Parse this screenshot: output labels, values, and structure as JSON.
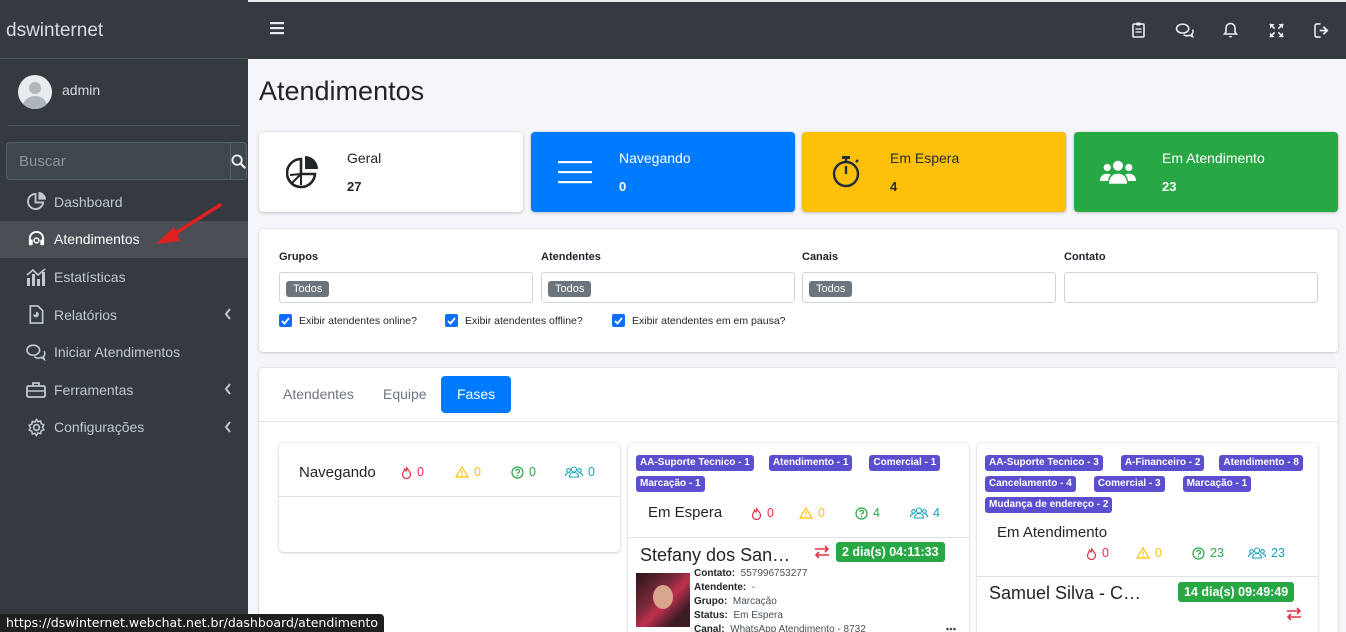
{
  "app": {
    "brand": "dswinternet"
  },
  "sidebar": {
    "user": "admin",
    "search_placeholder": "Buscar",
    "items": [
      {
        "label": "Dashboard"
      },
      {
        "label": "Atendimentos"
      },
      {
        "label": "Estatísticas"
      },
      {
        "label": "Relatórios"
      },
      {
        "label": "Iniciar Atendimentos"
      },
      {
        "label": "Ferramentas"
      },
      {
        "label": "Configurações"
      }
    ]
  },
  "page": {
    "title": "Atendimentos"
  },
  "stats": [
    {
      "label": "Geral",
      "value": "27"
    },
    {
      "label": "Navegando",
      "value": "0"
    },
    {
      "label": "Em Espera",
      "value": "4"
    },
    {
      "label": "Em Atendimento",
      "value": "23"
    }
  ],
  "filters": {
    "groups_label": "Grupos",
    "groups_value": "Todos",
    "agents_label": "Atendentes",
    "agents_value": "Todos",
    "channels_label": "Canais",
    "channels_value": "Todos",
    "contact_label": "Contato",
    "contact_value": "",
    "check_online": "Exibir atendentes online?",
    "check_offline": "Exibir atendentes offline?",
    "check_pause": "Exibir atendentes em em pausa?"
  },
  "tabs": [
    {
      "label": "Atendentes"
    },
    {
      "label": "Equipe"
    },
    {
      "label": "Fases"
    }
  ],
  "columns": {
    "navegando": {
      "title": "Navegando",
      "counts": [
        "0",
        "0",
        "0",
        "0"
      ]
    },
    "espera": {
      "title": "Em Espera",
      "badges": [
        "AA-Suporte Tecnico - 1",
        "Atendimento - 1",
        "Comercial - 1",
        "Marcação - 1"
      ],
      "counts": [
        "0",
        "0",
        "4",
        "4"
      ],
      "card": {
        "name": "Stefany dos San…",
        "timer": "2 dia(s) 04:11:33",
        "contato_label": "Contato:",
        "contato": "557996753277",
        "atendente_label": "Atendente:",
        "atendente": "-",
        "grupo_label": "Grupo:",
        "grupo": "Marcação",
        "status_label": "Status:",
        "status": "Em Espera",
        "canal_label": "Canal:",
        "canal": "WhatsApp Atendimento - 8732"
      }
    },
    "atendimento": {
      "title": "Em Atendimento",
      "badges": [
        "AA-Suporte Tecnico - 3",
        "A-Financeiro - 2",
        "Atendimento - 8",
        "Cancelamento - 4",
        "Comercial - 3",
        "Marcação - 1",
        "Mudança de endereço - 2"
      ],
      "counts": [
        "0",
        "0",
        "23",
        "23"
      ],
      "card": {
        "name": "Samuel Silva - C…",
        "timer": "14 dia(s) 09:49:49"
      }
    }
  },
  "statusbar": {
    "url": "https://dswinternet.webchat.net.br/dashboard/atendimento"
  },
  "colors": {
    "blue": "#007bff",
    "yellow": "#ffc107",
    "green": "#28a745",
    "sidebar": "#343a40"
  }
}
